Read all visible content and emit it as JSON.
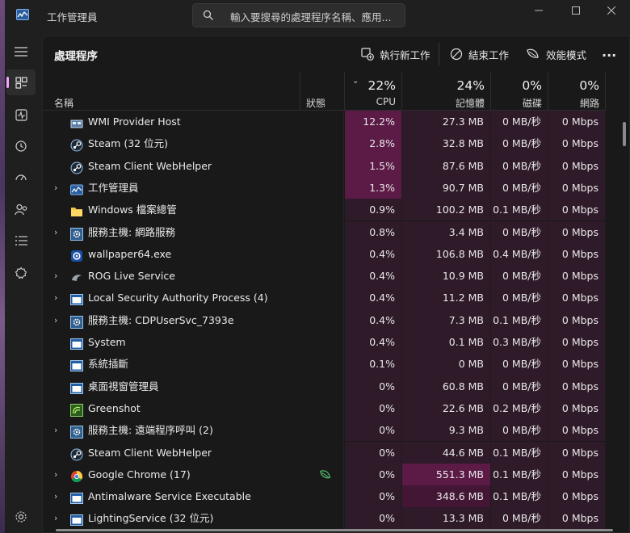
{
  "window": {
    "title": "工作管理員",
    "search_placeholder": "輸入要搜尋的處理程序名稱、應用..."
  },
  "nav": {
    "items": [
      {
        "name": "hamburger-icon"
      },
      {
        "name": "processes-icon",
        "active": true
      },
      {
        "name": "performance-icon"
      },
      {
        "name": "app-history-icon"
      },
      {
        "name": "startup-apps-icon"
      },
      {
        "name": "users-icon"
      },
      {
        "name": "details-icon"
      },
      {
        "name": "services-icon"
      }
    ],
    "settings": "gear-icon"
  },
  "header": {
    "title": "處理程序",
    "run_new_task": "執行新工作",
    "end_task": "結束工作",
    "efficiency_mode": "效能模式",
    "more": "..."
  },
  "columns": {
    "name": "名稱",
    "status": "狀態",
    "cpu": {
      "pct": "22%",
      "label": "CPU"
    },
    "memory": {
      "pct": "24%",
      "label": "記憶體"
    },
    "disk": {
      "pct": "0%",
      "label": "磁碟"
    },
    "network": {
      "pct": "0%",
      "label": "網路"
    }
  },
  "colors": {
    "heat_strong": "#5c1a46",
    "heat_medium": "#421634",
    "heat_light": "#2f1a29",
    "accent": "#f0a6ff"
  },
  "processes": [
    {
      "name": "WMI Provider Host",
      "icon": "wmi-icon",
      "expand": false,
      "status": "",
      "cpu": "12.2%",
      "memory": "27.3 MB",
      "disk": "0 MB/秒",
      "network": "0 Mbps",
      "cpu_heat": 3,
      "mem_heat": 1,
      "disk_heat": 1,
      "net_heat": 1
    },
    {
      "name": "Steam (32 位元)",
      "icon": "steam-icon",
      "expand": false,
      "status": "",
      "cpu": "2.8%",
      "memory": "32.8 MB",
      "disk": "0 MB/秒",
      "network": "0 Mbps",
      "cpu_heat": 3,
      "mem_heat": 1,
      "disk_heat": 1,
      "net_heat": 1
    },
    {
      "name": "Steam Client WebHelper",
      "icon": "steam-icon",
      "expand": false,
      "status": "",
      "cpu": "1.5%",
      "memory": "87.6 MB",
      "disk": "0 MB/秒",
      "network": "0 Mbps",
      "cpu_heat": 3,
      "mem_heat": 1,
      "disk_heat": 1,
      "net_heat": 1
    },
    {
      "name": "工作管理員",
      "icon": "task-manager-icon",
      "expand": true,
      "status": "",
      "cpu": "1.3%",
      "memory": "90.7 MB",
      "disk": "0 MB/秒",
      "network": "0 Mbps",
      "cpu_heat": 3,
      "mem_heat": 1,
      "disk_heat": 1,
      "net_heat": 1
    },
    {
      "name": "Windows 檔案總管",
      "icon": "folder-icon",
      "expand": false,
      "status": "",
      "cpu": "0.9%",
      "memory": "100.2 MB",
      "disk": "0.1 MB/秒",
      "network": "0 Mbps",
      "cpu_heat": 1,
      "mem_heat": 1,
      "disk_heat": 1,
      "net_heat": 1
    },
    {
      "name": "服務主機: 網路服務",
      "icon": "service-host-icon",
      "expand": true,
      "status": "",
      "cpu": "0.8%",
      "memory": "3.4 MB",
      "disk": "0 MB/秒",
      "network": "0 Mbps",
      "cpu_heat": 1,
      "mem_heat": 1,
      "disk_heat": 1,
      "net_heat": 1
    },
    {
      "name": "wallpaper64.exe",
      "icon": "wallpaper-icon",
      "expand": false,
      "status": "",
      "cpu": "0.4%",
      "memory": "106.8 MB",
      "disk": "0.4 MB/秒",
      "network": "0 Mbps",
      "cpu_heat": 1,
      "mem_heat": 1,
      "disk_heat": 1,
      "net_heat": 1
    },
    {
      "name": "ROG Live Service",
      "icon": "rog-icon",
      "expand": true,
      "status": "",
      "cpu": "0.4%",
      "memory": "10.9 MB",
      "disk": "0 MB/秒",
      "network": "0 Mbps",
      "cpu_heat": 1,
      "mem_heat": 1,
      "disk_heat": 1,
      "net_heat": 1
    },
    {
      "name": "Local Security Authority Process (4)",
      "icon": "app-window-icon",
      "expand": true,
      "status": "",
      "cpu": "0.4%",
      "memory": "11.2 MB",
      "disk": "0 MB/秒",
      "network": "0 Mbps",
      "cpu_heat": 1,
      "mem_heat": 1,
      "disk_heat": 1,
      "net_heat": 1
    },
    {
      "name": "服務主機: CDPUserSvc_7393e",
      "icon": "service-host-icon",
      "expand": true,
      "status": "",
      "cpu": "0.4%",
      "memory": "7.3 MB",
      "disk": "0.1 MB/秒",
      "network": "0 Mbps",
      "cpu_heat": 1,
      "mem_heat": 1,
      "disk_heat": 1,
      "net_heat": 1
    },
    {
      "name": "System",
      "icon": "app-window-icon",
      "expand": false,
      "status": "",
      "cpu": "0.4%",
      "memory": "0.1 MB",
      "disk": "0.3 MB/秒",
      "network": "0 Mbps",
      "cpu_heat": 1,
      "mem_heat": 1,
      "disk_heat": 1,
      "net_heat": 1
    },
    {
      "name": "系統插斷",
      "icon": "app-window-icon",
      "expand": false,
      "status": "",
      "cpu": "0.1%",
      "memory": "0 MB",
      "disk": "0 MB/秒",
      "network": "0 Mbps",
      "cpu_heat": 1,
      "mem_heat": 1,
      "disk_heat": 1,
      "net_heat": 1
    },
    {
      "name": "桌面視窗管理員",
      "icon": "app-window-icon",
      "expand": false,
      "status": "",
      "cpu": "0%",
      "memory": "60.8 MB",
      "disk": "0 MB/秒",
      "network": "0 Mbps",
      "cpu_heat": 1,
      "mem_heat": 1,
      "disk_heat": 1,
      "net_heat": 1
    },
    {
      "name": "Greenshot",
      "icon": "greenshot-icon",
      "expand": false,
      "status": "",
      "cpu": "0%",
      "memory": "22.6 MB",
      "disk": "0.2 MB/秒",
      "network": "0 Mbps",
      "cpu_heat": 1,
      "mem_heat": 1,
      "disk_heat": 1,
      "net_heat": 1
    },
    {
      "name": "服務主機: 遠端程序呼叫 (2)",
      "icon": "service-host-icon",
      "expand": true,
      "status": "",
      "cpu": "0%",
      "memory": "9.3 MB",
      "disk": "0 MB/秒",
      "network": "0 Mbps",
      "cpu_heat": 1,
      "mem_heat": 1,
      "disk_heat": 1,
      "net_heat": 1
    },
    {
      "name": "Steam Client WebHelper",
      "icon": "steam-icon",
      "expand": false,
      "status": "",
      "cpu": "0%",
      "memory": "44.6 MB",
      "disk": "0.1 MB/秒",
      "network": "0 Mbps",
      "cpu_heat": 1,
      "mem_heat": 1,
      "disk_heat": 1,
      "net_heat": 1
    },
    {
      "name": "Google Chrome (17)",
      "icon": "chrome-icon",
      "expand": true,
      "status": "efficiency-leaf-icon",
      "cpu": "0%",
      "memory": "551.3 MB",
      "disk": "0.1 MB/秒",
      "network": "0 Mbps",
      "cpu_heat": 1,
      "mem_heat": 3,
      "disk_heat": 1,
      "net_heat": 1
    },
    {
      "name": "Antimalware Service Executable",
      "icon": "app-window-icon",
      "expand": true,
      "status": "",
      "cpu": "0%",
      "memory": "348.6 MB",
      "disk": "0.1 MB/秒",
      "network": "0 Mbps",
      "cpu_heat": 1,
      "mem_heat": 2,
      "disk_heat": 1,
      "net_heat": 1
    },
    {
      "name": "LightingService (32 位元)",
      "icon": "app-window-icon",
      "expand": true,
      "status": "",
      "cpu": "0%",
      "memory": "13.3 MB",
      "disk": "0 MB/秒",
      "network": "0 Mbps",
      "cpu_heat": 1,
      "mem_heat": 1,
      "disk_heat": 1,
      "net_heat": 1
    }
  ]
}
